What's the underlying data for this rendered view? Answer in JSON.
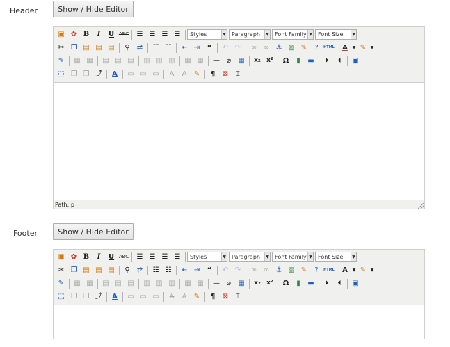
{
  "sections": [
    {
      "label": "Header",
      "toggle_label": "Show / Hide Editor",
      "selects": {
        "styles": "Styles",
        "format": "Paragraph",
        "font_family": "Font Family",
        "font_size": "Font Size"
      },
      "path_text": "Path: p"
    },
    {
      "label": "Footer",
      "toggle_label": "Show / Hide Editor",
      "selects": {
        "styles": "Styles",
        "format": "Paragraph",
        "font_family": "Font Family",
        "font_size": "Font Size"
      }
    }
  ],
  "glyphs": {
    "bold": "B",
    "italic": "I",
    "underline": "U",
    "strike": "ABC",
    "subscript": "x₂",
    "superscript": "x²",
    "omega": "Ω",
    "pilcrow": "¶",
    "text_color": "A",
    "html": "HTML",
    "quote": "“",
    "dash": "—"
  },
  "colors": {
    "accent_red": "#c0392b",
    "accent_blue": "#1f5fbf",
    "toolbar_bg": "#f0f0ee"
  }
}
